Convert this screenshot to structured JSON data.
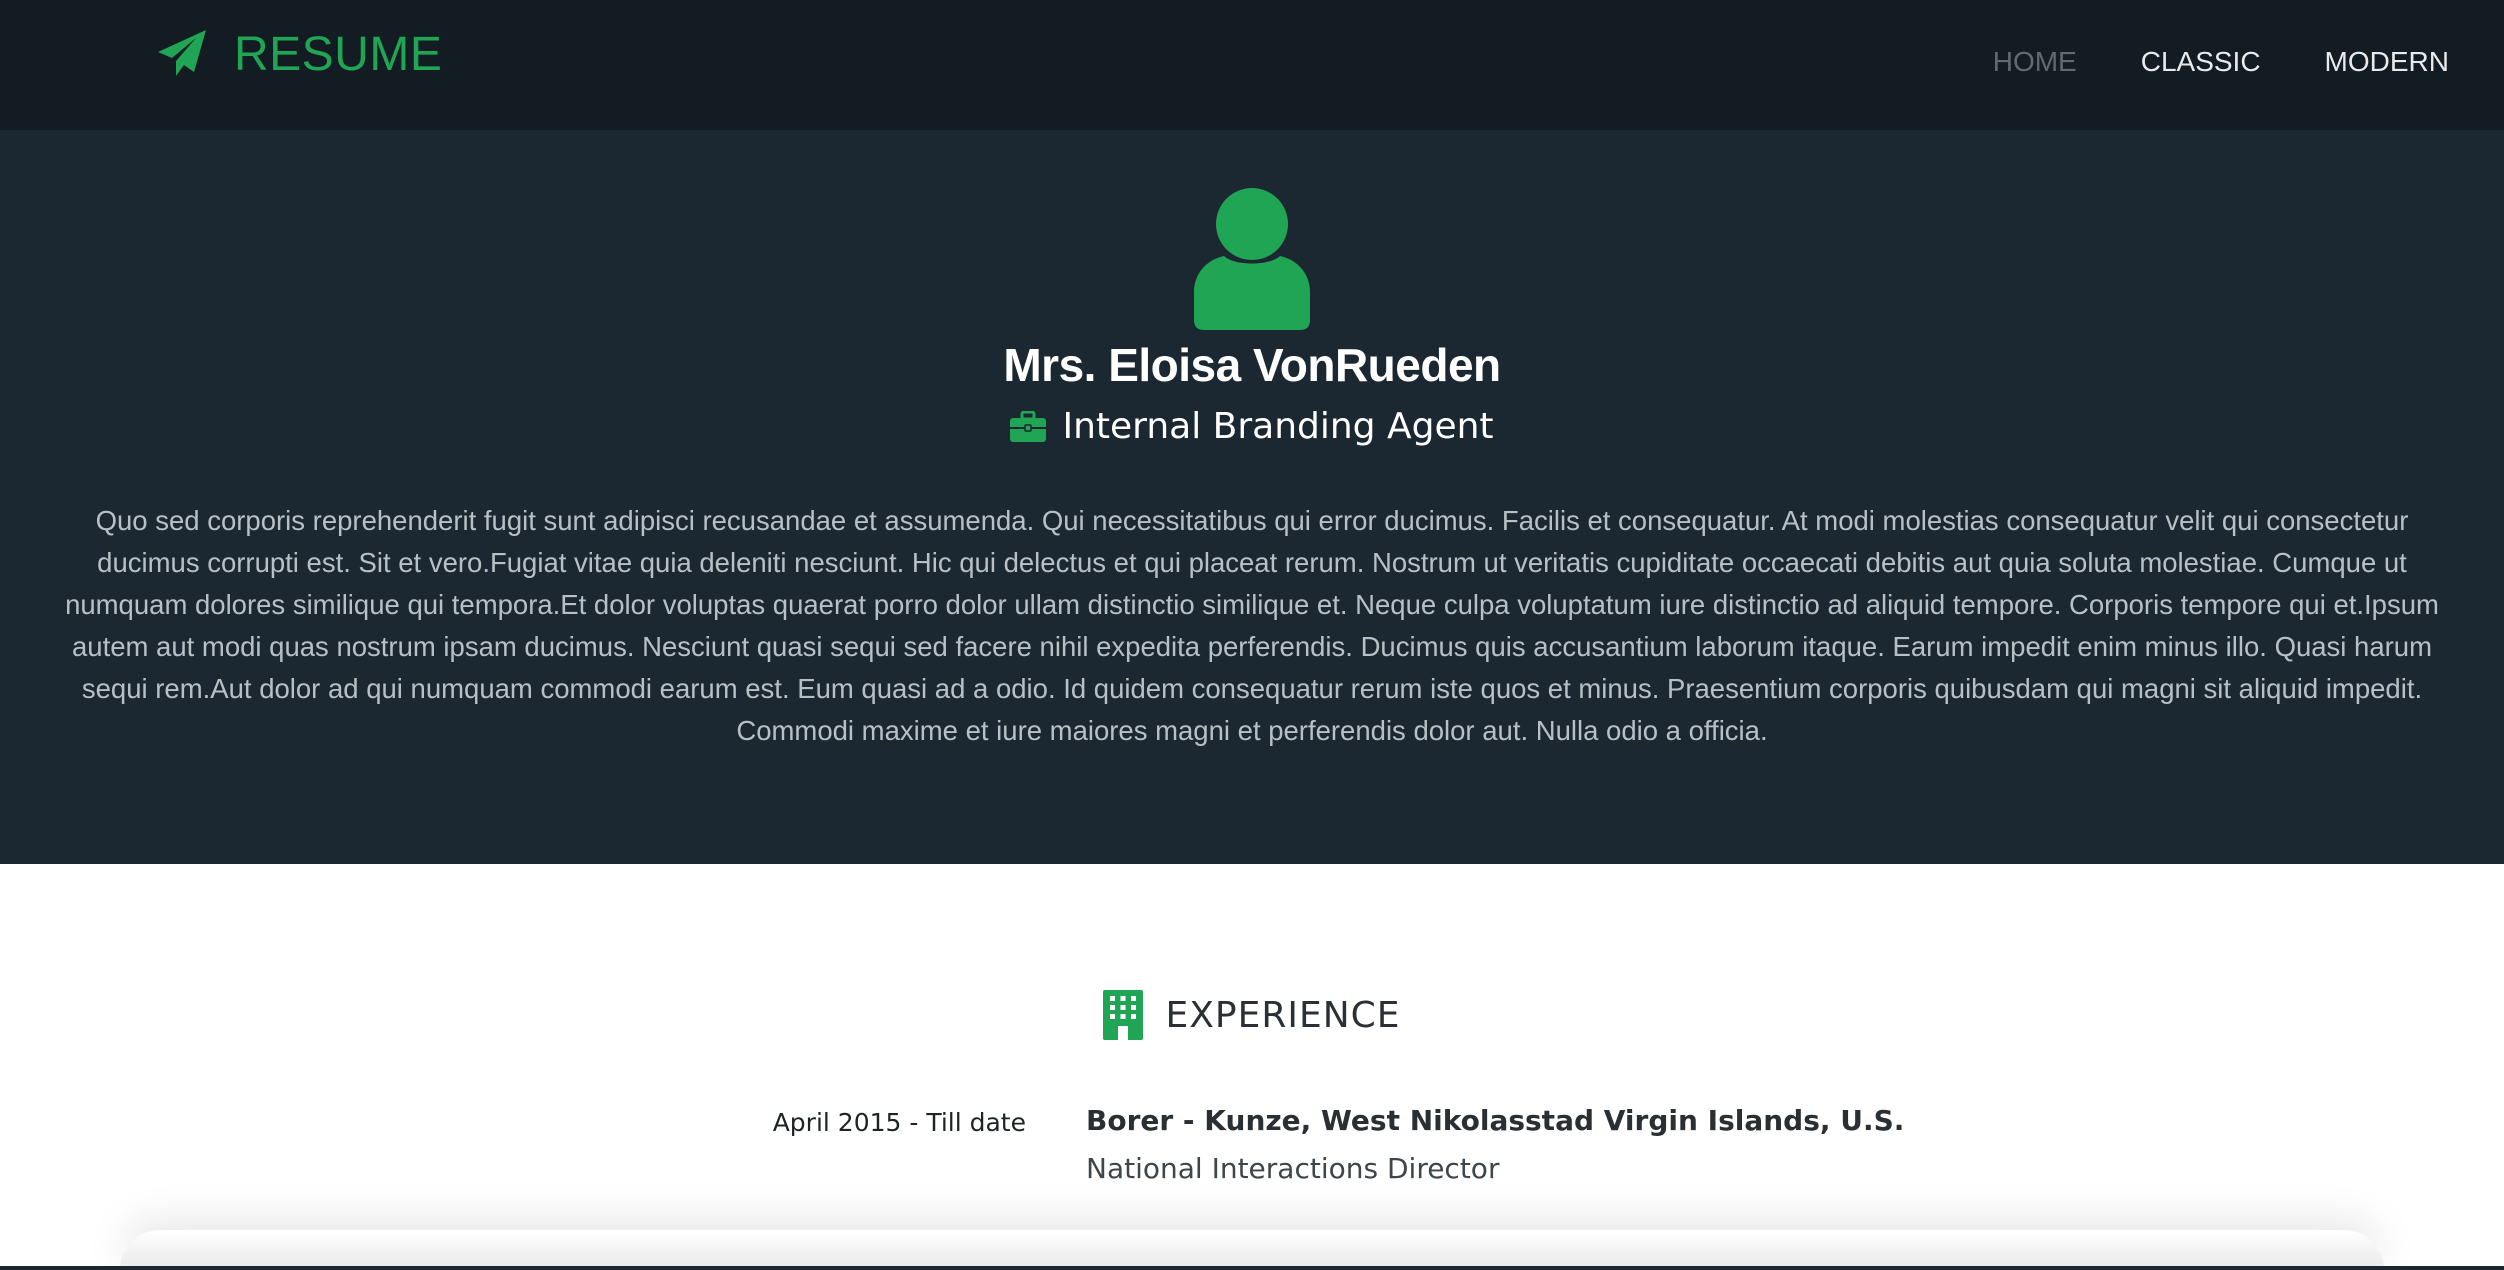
{
  "navbar": {
    "brand": "RESUME",
    "items": [
      {
        "label": "HOME",
        "active": true
      },
      {
        "label": "CLASSIC",
        "active": false
      },
      {
        "label": "MODERN",
        "active": false
      }
    ]
  },
  "profile": {
    "avatar_icon": "user-icon",
    "name": "Mrs. Eloisa VonRueden",
    "job_icon": "briefcase-icon",
    "job_title": "Internal Branding Agent",
    "bio": "Quo sed corporis reprehenderit fugit sunt adipisci recusandae et assumenda. Qui necessitatibus qui error ducimus. Facilis et consequatur. At modi molestias consequatur velit qui consectetur ducimus corrupti est. Sit et vero.Fugiat vitae quia deleniti nesciunt. Hic qui delectus et qui placeat rerum. Nostrum ut veritatis cupiditate occaecati debitis aut quia soluta molestiae. Cumque ut numquam dolores similique qui tempora.Et dolor voluptas quaerat porro dolor ullam distinctio similique et. Neque culpa voluptatum iure distinctio ad aliquid tempore. Corporis tempore qui et.Ipsum autem aut modi quas nostrum ipsam ducimus. Nesciunt quasi sequi sed facere nihil expedita perferendis. Ducimus quis accusantium laborum itaque. Earum impedit enim minus illo. Quasi harum sequi rem.Aut dolor ad qui numquam commodi earum est. Eum quasi ad a odio. Id quidem consequatur rerum iste quos et minus. Praesentium corporis quibusdam qui magni sit aliquid impedit. Commodi maxime et iure maiores magni et perferendis dolor aut. Nulla odio a officia."
  },
  "experience": {
    "icon": "building-icon",
    "title": "EXPERIENCE",
    "entries": [
      {
        "date": "April 2015 - Till date",
        "company": "Borer - Kunze, West Nikolasstad Virgin Islands, U.S.",
        "role": "National Interactions Director"
      }
    ]
  },
  "colors": {
    "accent": "#1fa553",
    "navbar_bg": "#131c23",
    "hero_bg": "#1c2831"
  }
}
